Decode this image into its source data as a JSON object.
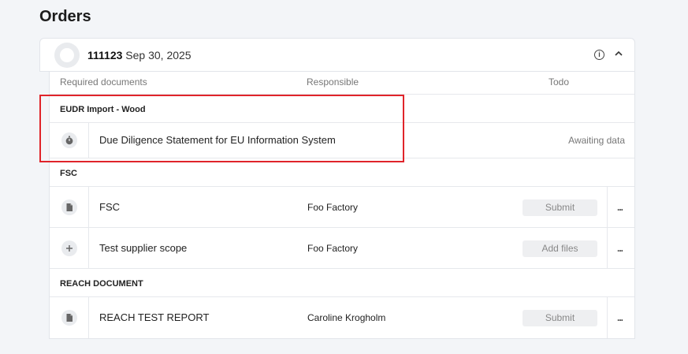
{
  "page": {
    "title": "Orders"
  },
  "order": {
    "number": "111123",
    "date": "Sep 30, 2025"
  },
  "table": {
    "headers": {
      "documents": "Required documents",
      "responsible": "Responsible",
      "todo": "Todo"
    },
    "groups": [
      {
        "label": "EUDR Import - Wood",
        "rows": [
          {
            "icon": "stopwatch-icon",
            "name": "Due Diligence Statement for EU Information System",
            "responsible": "",
            "status": "Awaiting data"
          }
        ]
      },
      {
        "label": "FSC",
        "rows": [
          {
            "icon": "document-icon",
            "name": "FSC",
            "responsible": "Foo Factory",
            "action": "Submit",
            "more": "..."
          },
          {
            "icon": "plus-icon",
            "name": "Test supplier scope",
            "responsible": "Foo Factory",
            "action": "Add files",
            "more": "..."
          }
        ]
      },
      {
        "label": "REACH DOCUMENT",
        "rows": [
          {
            "icon": "document-icon",
            "name": "REACH TEST REPORT",
            "responsible": "Caroline Krogholm",
            "action": "Submit",
            "more": "..."
          }
        ]
      }
    ]
  },
  "colors": {
    "highlight": "#e0242a",
    "background": "#f3f5f8"
  }
}
